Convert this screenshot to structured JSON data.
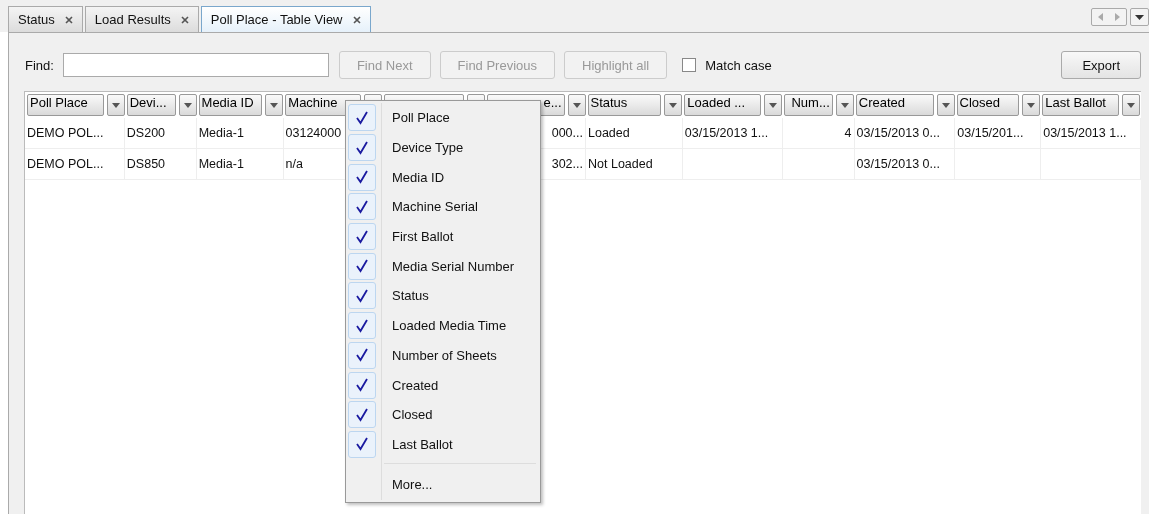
{
  "tabs": [
    {
      "label": "Status",
      "selected": false
    },
    {
      "label": "Load Results",
      "selected": false
    },
    {
      "label": "Poll Place - Table View",
      "selected": true
    }
  ],
  "find": {
    "label": "Find:",
    "buttons": [
      {
        "label": "Find Next",
        "disabled": true
      },
      {
        "label": "Find Previous",
        "disabled": true
      },
      {
        "label": "Highlight all",
        "disabled": true
      }
    ],
    "match_case": {
      "label": "Match case",
      "checked": false
    }
  },
  "export_button": {
    "label": "Export",
    "disabled": false
  },
  "table": {
    "columns": [
      {
        "label": "Poll Place"
      },
      {
        "label": "Devi..."
      },
      {
        "label": "Media ID"
      },
      {
        "label": "Machine"
      },
      {},
      {
        "label": "e..."
      },
      {
        "label": "Status"
      },
      {
        "label": "Loaded ..."
      },
      {
        "label": "Num..."
      },
      {
        "label": "Created"
      },
      {
        "label": "Closed"
      },
      {
        "label": "Last Ballot"
      }
    ],
    "rows": [
      {
        "cells": [
          "DEMO POL...",
          "DS200",
          "Media-1",
          "03124000",
          null,
          "000...",
          "Loaded",
          "03/15/2013 1...",
          "4",
          "03/15/2013 0...",
          "03/15/201...",
          "03/15/2013 1..."
        ]
      },
      {
        "cells": [
          "DEMO POL...",
          "DS850",
          "Media-1",
          "n/a",
          null,
          "302...",
          "Not Loaded",
          null,
          null,
          "03/15/2013 0...",
          null,
          null
        ]
      }
    ]
  },
  "column_menu": {
    "items": [
      {
        "label": "Poll Place",
        "checked": true
      },
      {
        "label": "Device Type",
        "checked": true
      },
      {
        "label": "Media ID",
        "checked": true
      },
      {
        "label": "Machine Serial",
        "checked": true
      },
      {
        "label": "First Ballot",
        "checked": true
      },
      {
        "label": "Media Serial Number",
        "checked": true
      },
      {
        "label": "Status",
        "checked": true
      },
      {
        "label": "Loaded Media Time",
        "checked": true
      },
      {
        "label": "Number of Sheets",
        "checked": true
      },
      {
        "label": "Created",
        "checked": true
      },
      {
        "label": "Closed",
        "checked": true
      },
      {
        "label": "Last Ballot",
        "checked": true
      }
    ],
    "more": "More..."
  }
}
